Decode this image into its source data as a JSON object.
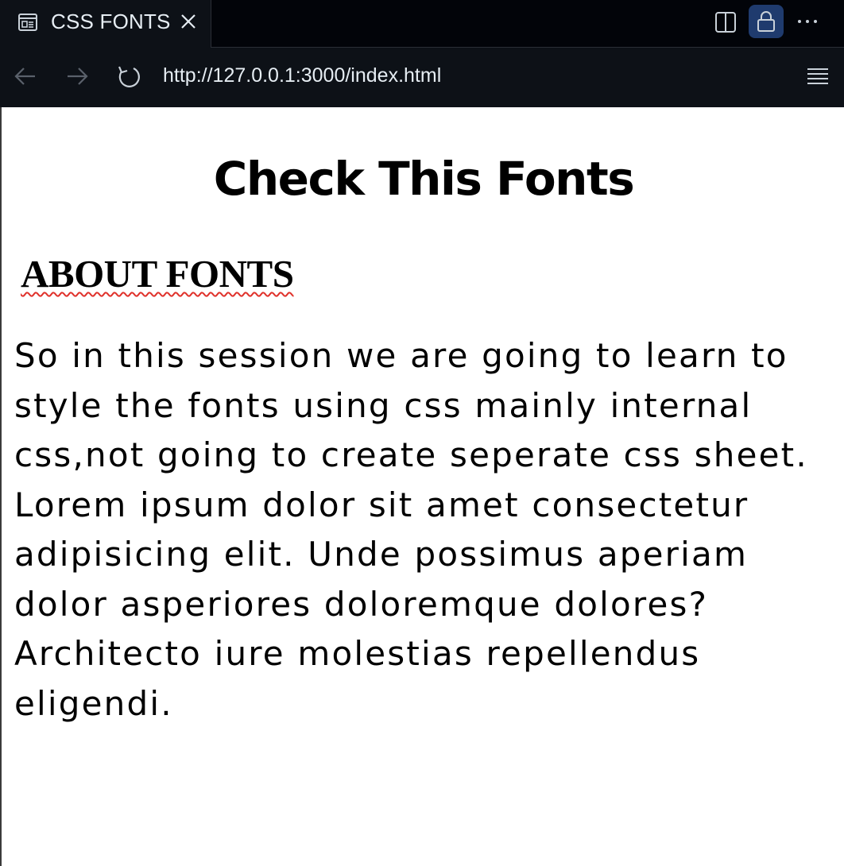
{
  "tab": {
    "title": "CSS FONTS",
    "icon": "preview-icon",
    "close_icon": "close-icon"
  },
  "toolbar": {
    "split_icon": "split-editor-icon",
    "lock_icon": "lock-icon",
    "more_icon": "more-actions-icon"
  },
  "address_bar": {
    "url": "http://127.0.0.1:3000/index.html",
    "back_icon": "back-arrow-icon",
    "forward_icon": "forward-arrow-icon",
    "reload_icon": "reload-icon",
    "menu_icon": "menu-icon"
  },
  "page": {
    "title": "Check This Fonts",
    "heading": "ABOUT FONTS",
    "paragraph": "So in this session we are going to learn to style the fonts using css mainly internal css,not going to create seperate css sheet. Lorem ipsum dolor sit amet consectetur adipisicing elit. Unde possimus aperiam dolor asperiores doloremque dolores? Architecto iure molestias repellendus eligendi."
  },
  "colors": {
    "tabbar_bg": "#020409",
    "navbar_bg": "#0d1117",
    "lock_active_bg": "#1f3b6e",
    "text_light": "#e6edf3",
    "spellcheck_underline": "#e0322b"
  }
}
